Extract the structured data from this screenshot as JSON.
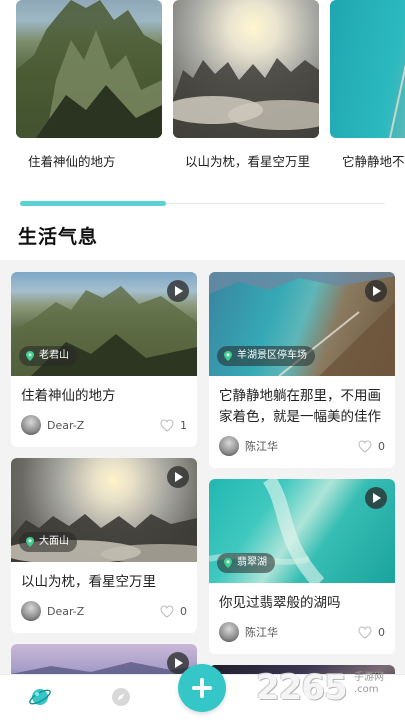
{
  "carousel": {
    "items": [
      {
        "title": "住着神仙的地方"
      },
      {
        "title": "以山为枕，看星空万里"
      },
      {
        "title": "它静静地不用画家"
      }
    ]
  },
  "section": {
    "title": "生活气息"
  },
  "feed": {
    "left": [
      {
        "location": "老君山",
        "title": "住着神仙的地方",
        "author": "Dear-Z",
        "likes": "1"
      },
      {
        "location": "大面山",
        "title": "以山为枕，看星空万里",
        "author": "Dear-Z",
        "likes": "0"
      },
      {
        "location": "",
        "title": "",
        "author": "",
        "likes": ""
      }
    ],
    "right": [
      {
        "location": "羊湖景区停车场",
        "title": "它静静地躺在那里，不用画家着色，就是一幅美的佳作",
        "author": "陈江华",
        "likes": "0"
      },
      {
        "location": "翡翠湖",
        "title": "你见过翡翠般的湖吗",
        "author": "陈江华",
        "likes": "0"
      },
      {
        "location": "",
        "title": "",
        "author": "",
        "likes": ""
      }
    ]
  },
  "nav": {
    "home_icon": "planet-icon",
    "discover_icon": "compass-icon",
    "add_icon": "plus-icon"
  },
  "watermark": {
    "brand": "2265",
    "sub_top": "手游网",
    "sub_bottom": ".com"
  },
  "colors": {
    "accent": "#35c7c8",
    "feed_bg": "#f3f3f3"
  }
}
